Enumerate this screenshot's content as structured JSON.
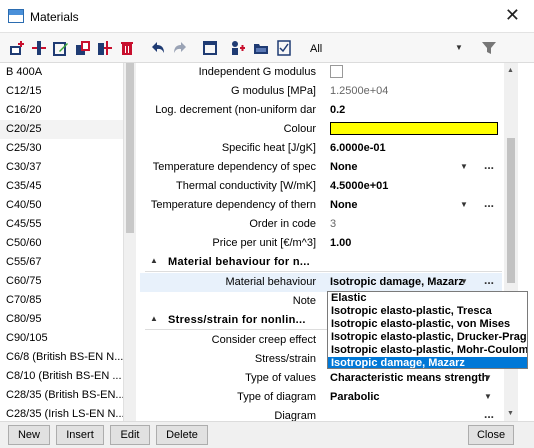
{
  "window": {
    "title": "Materials",
    "close_glyph": "✕"
  },
  "toolbar": {
    "icons": [
      "new-icon",
      "insert-icon",
      "edit-icon",
      "copy-icon",
      "paste-icon",
      "delete-icon",
      "undo-icon",
      "redo-icon",
      "table-icon",
      "users-icon",
      "open-icon",
      "check-icon",
      "filter-icon"
    ],
    "filter_label": "All",
    "accent_colors": {
      "red": "#c8102e",
      "blue": "#1f3b73",
      "green": "#3aa53a"
    }
  },
  "materials_list": {
    "items": [
      "B 400A",
      "C12/15",
      "C16/20",
      "C20/25",
      "C25/30",
      "C30/37",
      "C35/45",
      "C40/50",
      "C45/55",
      "C50/60",
      "C55/67",
      "C60/75",
      "C70/85",
      "C80/95",
      "C90/105",
      "C6/8 (British BS-EN N...",
      "C8/10 (British BS-EN ...",
      "C28/35 (British BS-EN...",
      "C28/35 (Irish LS-EN N..."
    ],
    "selected": "C20/25"
  },
  "properties": {
    "independent_g": {
      "label": "Independent G modulus",
      "checked": false
    },
    "g_modulus": {
      "label": "G modulus [MPa]",
      "value": "1.2500e+04"
    },
    "log_decrement": {
      "label": "Log. decrement (non-uniform dar",
      "value": "0.2"
    },
    "colour": {
      "label": "Colour",
      "value": "#ffff00"
    },
    "specific_heat": {
      "label": "Specific heat [J/gK]",
      "value": "6.0000e-01"
    },
    "temp_dep_spec": {
      "label": "Temperature dependency of spec",
      "value": "None"
    },
    "thermal_cond": {
      "label": "Thermal conductivity [W/mK]",
      "value": "4.5000e+01"
    },
    "temp_dep_therm": {
      "label": "Temperature dependency of thern",
      "value": "None"
    },
    "order_in_code": {
      "label": "Order in code",
      "value": "3"
    },
    "price": {
      "label": "Price per unit [€/m^3]",
      "value": "1.00"
    }
  },
  "section_behaviour": {
    "title": "Material behaviour for n...",
    "material_behaviour": {
      "label": "Material behaviour",
      "value": "Isotropic damage, Mazarz"
    },
    "note": {
      "label": "Note"
    }
  },
  "section_stress": {
    "title": "Stress/strain for nonlin...",
    "creep": {
      "label": "Consider creep effect"
    },
    "stress_strain": {
      "label": "Stress/strain"
    },
    "type_values": {
      "label": "Type of values",
      "value": "Characteristic means strength"
    },
    "type_diagram": {
      "label": "Type of diagram",
      "value": "Parabolic"
    },
    "diagram": {
      "label": "Diagram"
    }
  },
  "dropdown": {
    "options": [
      "Elastic",
      "Isotropic elasto-plastic, Tresca",
      "Isotropic elasto-plastic, von Mises",
      "Isotropic elasto-plastic, Drucker-Prager",
      "Isotropic elasto-plastic, Mohr-Coulomb",
      "Isotropic damage, Mazarz"
    ],
    "highlighted": "Isotropic damage, Mazarz"
  },
  "buttons": {
    "new": "New",
    "insert": "Insert",
    "edit": "Edit",
    "delete": "Delete",
    "close": "Close"
  },
  "glyphs": {
    "dropdown_arrow": "▼",
    "more": "...",
    "collapse": "▲"
  }
}
